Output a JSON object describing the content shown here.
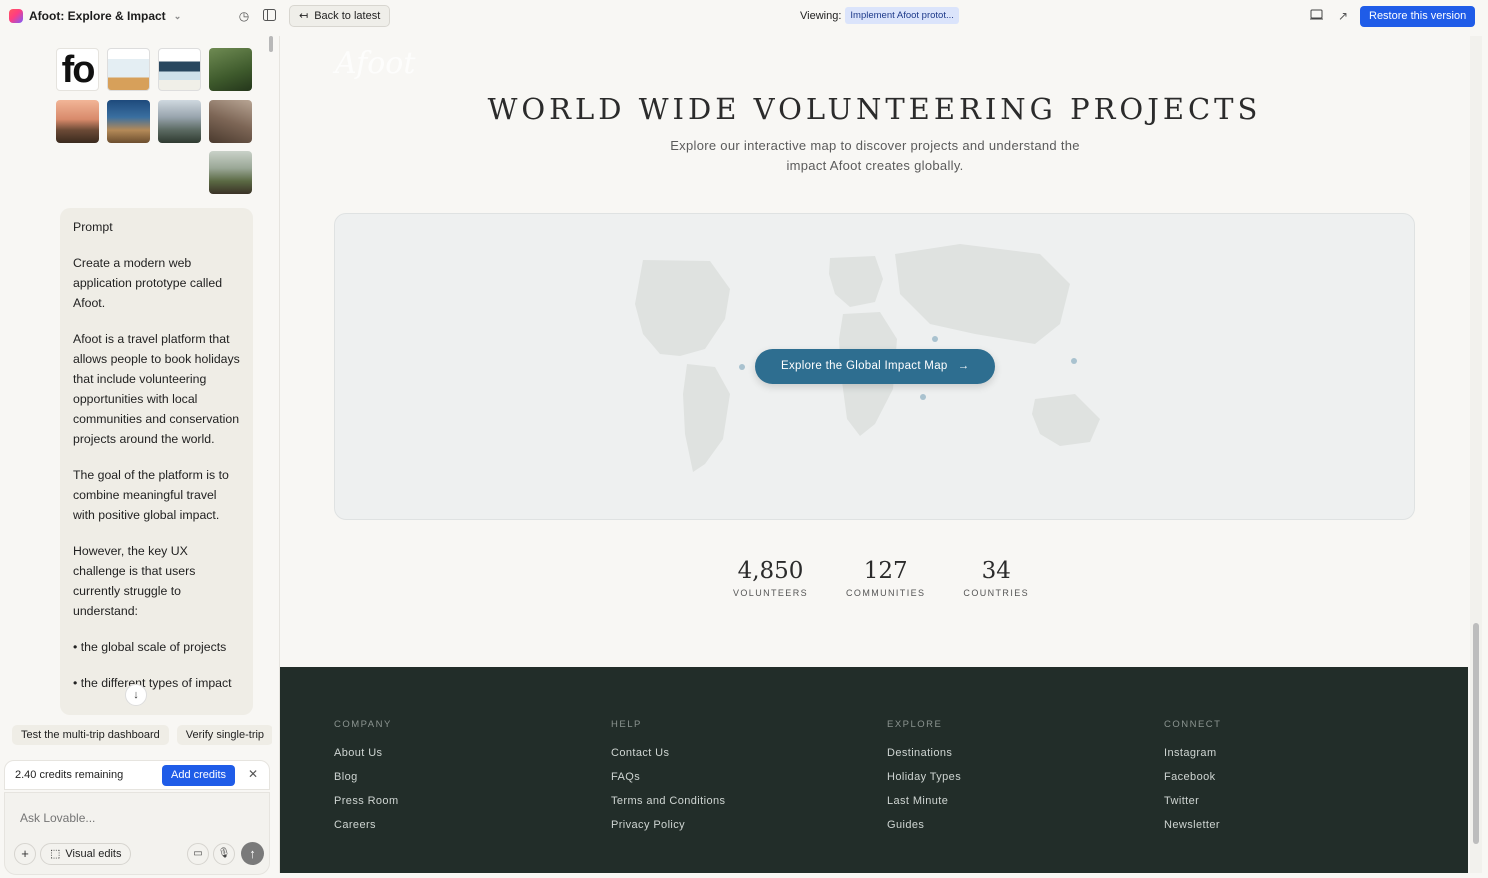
{
  "topbar": {
    "project_name": "Afoot: Explore & Impact",
    "back_label": "Back to latest",
    "viewing_label": "Viewing:",
    "viewing_chip": "Implement Afoot protot...",
    "restore_label": "Restore this version"
  },
  "sidebar": {
    "thumb_fo": "fo",
    "prompt_title": "Prompt",
    "prompt_paragraphs": [
      "Create a modern web application prototype called Afoot.",
      "Afoot is a travel platform that allows people to book holidays that include volunteering opportunities with local communities and conservation projects around the world.",
      "The goal of the platform is to combine meaningful travel with positive global impact.",
      "However, the key UX challenge is that users currently struggle to understand:",
      "• the global scale of projects",
      "• the different types of impact"
    ],
    "chips": [
      "Test the multi-trip dashboard",
      "Verify single-trip"
    ],
    "credits_text": "2.40 credits remaining",
    "add_credits": "Add credits",
    "ask_placeholder": "Ask Lovable...",
    "visual_edits": "Visual edits"
  },
  "preview": {
    "logo": "Afoot",
    "title": "WORLD WIDE VOLUNTEERING PROJECTS",
    "subtitle": "Explore our interactive map to discover projects and understand the impact Afoot creates globally.",
    "map_cta": "Explore the Global Impact Map",
    "stats": [
      {
        "value": "4,850",
        "label": "VOLUNTEERS"
      },
      {
        "value": "127",
        "label": "COMMUNITIES"
      },
      {
        "value": "34",
        "label": "COUNTRIES"
      }
    ],
    "footer": [
      {
        "heading": "COMPANY",
        "links": [
          "About Us",
          "Blog",
          "Press Room",
          "Careers"
        ]
      },
      {
        "heading": "HELP",
        "links": [
          "Contact Us",
          "FAQs",
          "Terms and Conditions",
          "Privacy Policy"
        ]
      },
      {
        "heading": "EXPLORE",
        "links": [
          "Destinations",
          "Holiday Types",
          "Last Minute",
          "Guides"
        ]
      },
      {
        "heading": "CONNECT",
        "links": [
          "Instagram",
          "Facebook",
          "Twitter",
          "Newsletter"
        ]
      }
    ]
  },
  "colors": {
    "accent": "#1f5ce8",
    "map_cta": "#2e6e90",
    "footer_bg": "#222d29"
  }
}
